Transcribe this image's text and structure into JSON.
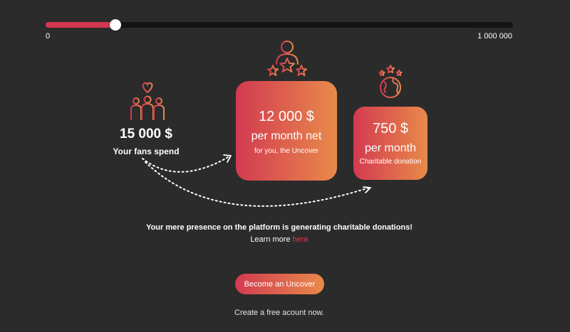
{
  "slider": {
    "min_label": "0",
    "max_label": "1 000 000",
    "value_fraction": 0.15
  },
  "fans": {
    "amount": "15 000 $",
    "label": "Your fans spend",
    "icon": "fans-heart-icon"
  },
  "creator_card": {
    "amount": "12 000 $",
    "period": "per month net",
    "subtitle": "for you, the Uncover",
    "icon": "creator-stars-icon"
  },
  "charity_card": {
    "amount": "750 $",
    "period": "per month",
    "subtitle": "Charitable donation",
    "icon": "globe-donation-icon"
  },
  "message": {
    "text": "Your mere presence on the platform is generating charitable donations!",
    "learn_more_prefix": "Learn more",
    "link_text": "here"
  },
  "cta": {
    "label": "Become an Uncover",
    "subtext": "Create a free acount now."
  },
  "colors": {
    "background": "#2b2b2b",
    "accent_start": "#d33a51",
    "accent_end": "#e88a4a",
    "link": "#e0394e"
  }
}
